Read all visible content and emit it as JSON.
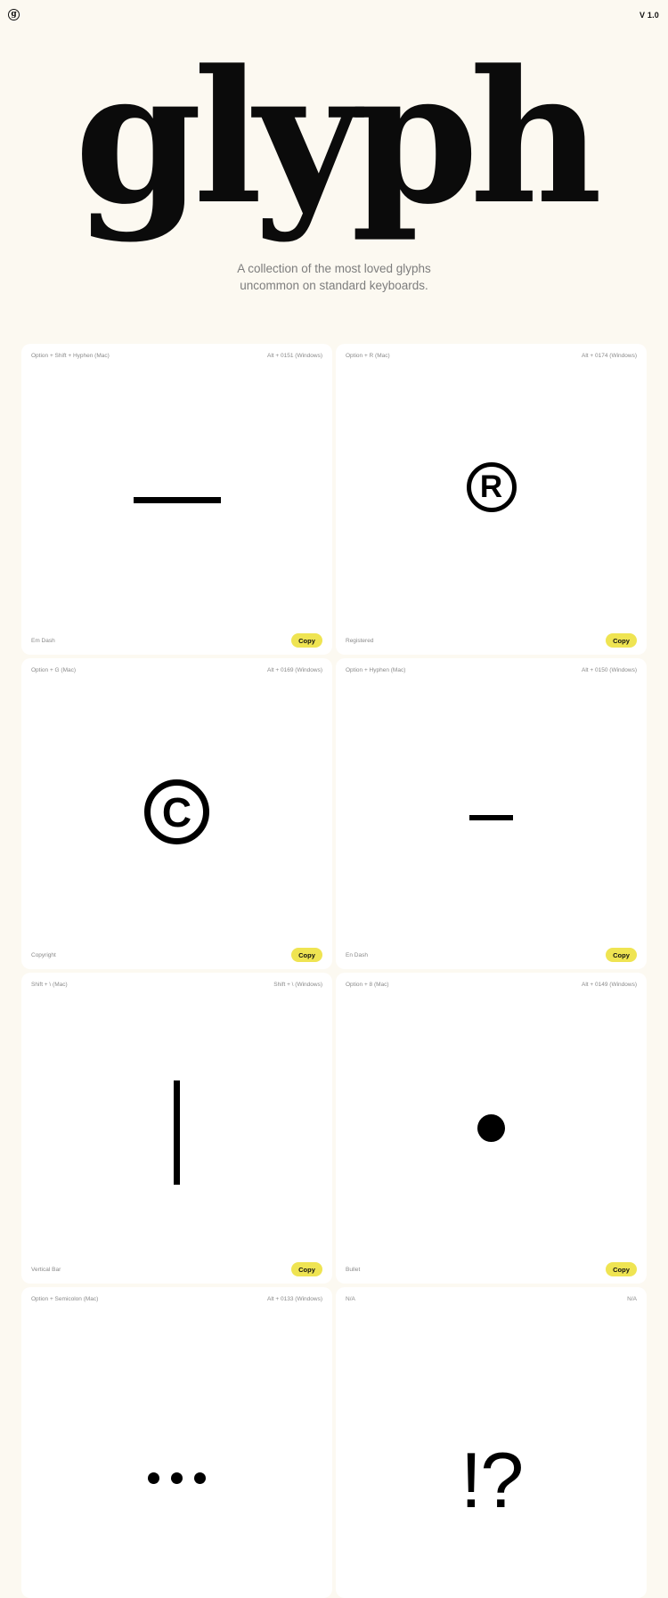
{
  "header": {
    "logo_letter": "g",
    "version": "V 1.0"
  },
  "hero": {
    "title": "glyph",
    "subtitle_line1": "A collection of the most loved glyphs",
    "subtitle_line2": "uncommon on standard keyboards."
  },
  "cards": [
    {
      "mac": "Option + Shift + Hyphen (Mac)",
      "windows": "Alt + 0151 (Windows)",
      "name": "Em Dash",
      "glyph": "—",
      "copy_label": "Copy"
    },
    {
      "mac": "Option + R (Mac)",
      "windows": "Alt + 0174 (Windows)",
      "name": "Registered",
      "glyph": "R",
      "copy_label": "Copy"
    },
    {
      "mac": "Option + G (Mac)",
      "windows": "Alt + 0169 (Windows)",
      "name": "Copyright",
      "glyph": "C",
      "copy_label": "Copy"
    },
    {
      "mac": "Option + Hyphen (Mac)",
      "windows": "Alt + 0150 (Windows)",
      "name": "En Dash",
      "glyph": "–",
      "copy_label": "Copy"
    },
    {
      "mac": "Shift + \\ (Mac)",
      "windows": "Shift + \\ (Windows)",
      "name": "Vertical Bar",
      "glyph": "|",
      "copy_label": "Copy"
    },
    {
      "mac": "Option + 8 (Mac)",
      "windows": "Alt + 0149 (Windows)",
      "name": "Bullet",
      "glyph": "•",
      "copy_label": "Copy"
    },
    {
      "mac": "Option + Semicolon (Mac)",
      "windows": "Alt + 0133 (Windows)",
      "name": "",
      "glyph": "…",
      "copy_label": ""
    },
    {
      "mac": "N/A",
      "windows": "N/A",
      "name": "",
      "glyph": "!?",
      "copy_label": ""
    }
  ],
  "colors": {
    "background": "#fcf9f1",
    "card": "#ffffff",
    "copy_button": "#efe452",
    "muted_text": "#8a8a8a"
  }
}
